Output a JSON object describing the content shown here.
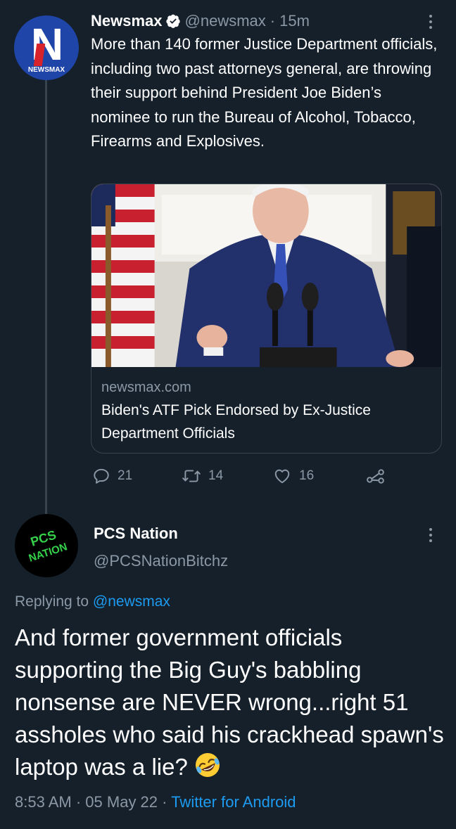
{
  "tweet": {
    "author": {
      "name": "Newsmax",
      "handle": "@newsmax",
      "avatar_text": "NEWSMAX",
      "avatar_letter": "N",
      "verified": true
    },
    "time_ago": "15m",
    "text": "More than 140 former Justice Department officials, including two past attorneys general, are throwing their support behind President Joe Biden’s nominee to run the Bureau of Alcohol, Tobacco, Firearms and Explosives.",
    "link_card": {
      "domain": "newsmax.com",
      "title": "Biden's ATF Pick Endorsed by Ex-Justice Department Officials"
    },
    "actions": {
      "replies": "21",
      "retweets": "14",
      "likes": "16"
    }
  },
  "reply": {
    "author": {
      "name": "PCS Nation",
      "handle": "@PCSNationBitchz",
      "avatar_line1": "PCS",
      "avatar_line2": "NATION"
    },
    "replying_to_prefix": "Replying to",
    "replying_to_handle": "@newsmax",
    "text": "And former government officials supporting the Big Guy's babbling nonsense are NEVER wrong...right 51 assholes who said his crackhead spawn's laptop was a lie?",
    "emoji": "rolling-on-the-floor-laughing",
    "time": "8:53 AM",
    "date": "05 May 22",
    "source": "Twitter for Android",
    "separator": "·"
  },
  "colors": {
    "background": "#15202b",
    "secondary_text": "#8b98a5",
    "link_blue": "#1d9bf0",
    "border": "#38444d"
  }
}
